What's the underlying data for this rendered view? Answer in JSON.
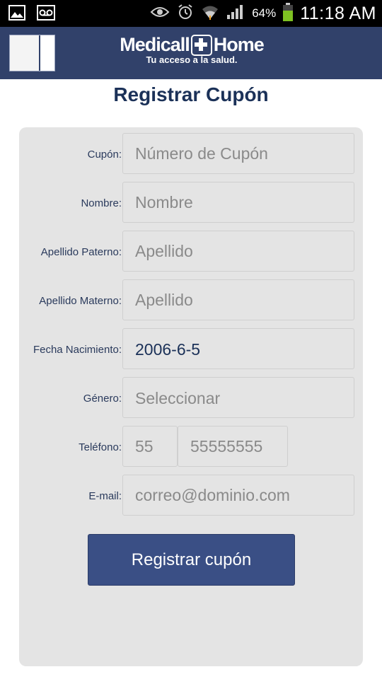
{
  "statusbar": {
    "battery_pct": "64%",
    "time": "11:18 AM"
  },
  "header": {
    "logo_left": "Medicall",
    "logo_right": "Home",
    "tagline": "Tu acceso a la salud."
  },
  "page": {
    "title": "Registrar Cupón"
  },
  "form": {
    "coupon": {
      "label": "Cupón:",
      "placeholder": "Número de Cupón",
      "value": ""
    },
    "first_name": {
      "label": "Nombre:",
      "placeholder": "Nombre",
      "value": ""
    },
    "paternal_surname": {
      "label": "Apellido Paterno:",
      "placeholder": "Apellido",
      "value": ""
    },
    "maternal_surname": {
      "label": "Apellido Materno:",
      "placeholder": "Apellido",
      "value": ""
    },
    "birth_date": {
      "label": "Fecha Nacimiento:",
      "value": "2006-6-5"
    },
    "gender": {
      "label": "Género:",
      "value": "Seleccionar"
    },
    "phone": {
      "label": "Teléfono:",
      "area_placeholder": "55",
      "number_placeholder": "55555555"
    },
    "email": {
      "label": "E-mail:",
      "placeholder": "correo@dominio.com",
      "value": ""
    },
    "submit_label": "Registrar cupón"
  }
}
